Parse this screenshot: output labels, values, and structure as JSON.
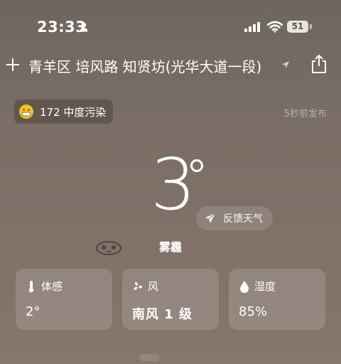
{
  "status_bar": {
    "time": "23:33",
    "battery": "51"
  },
  "location": {
    "text": "青羊区 培风路 知贤坊(光华大道一段)"
  },
  "air_quality": {
    "label": "172 中度污染"
  },
  "publish_time": "5秒前发布",
  "weather": {
    "temperature": "3",
    "condition": "雾霾"
  },
  "feedback": {
    "label": "反馈天气"
  },
  "cards": [
    {
      "label": "体感",
      "value": "2°",
      "icon": "thermometer-icon"
    },
    {
      "label": "风",
      "value": "南风 1 级",
      "icon": "fan-icon"
    },
    {
      "label": "湿度",
      "value": "85%",
      "icon": "water-drop-icon"
    }
  ]
}
